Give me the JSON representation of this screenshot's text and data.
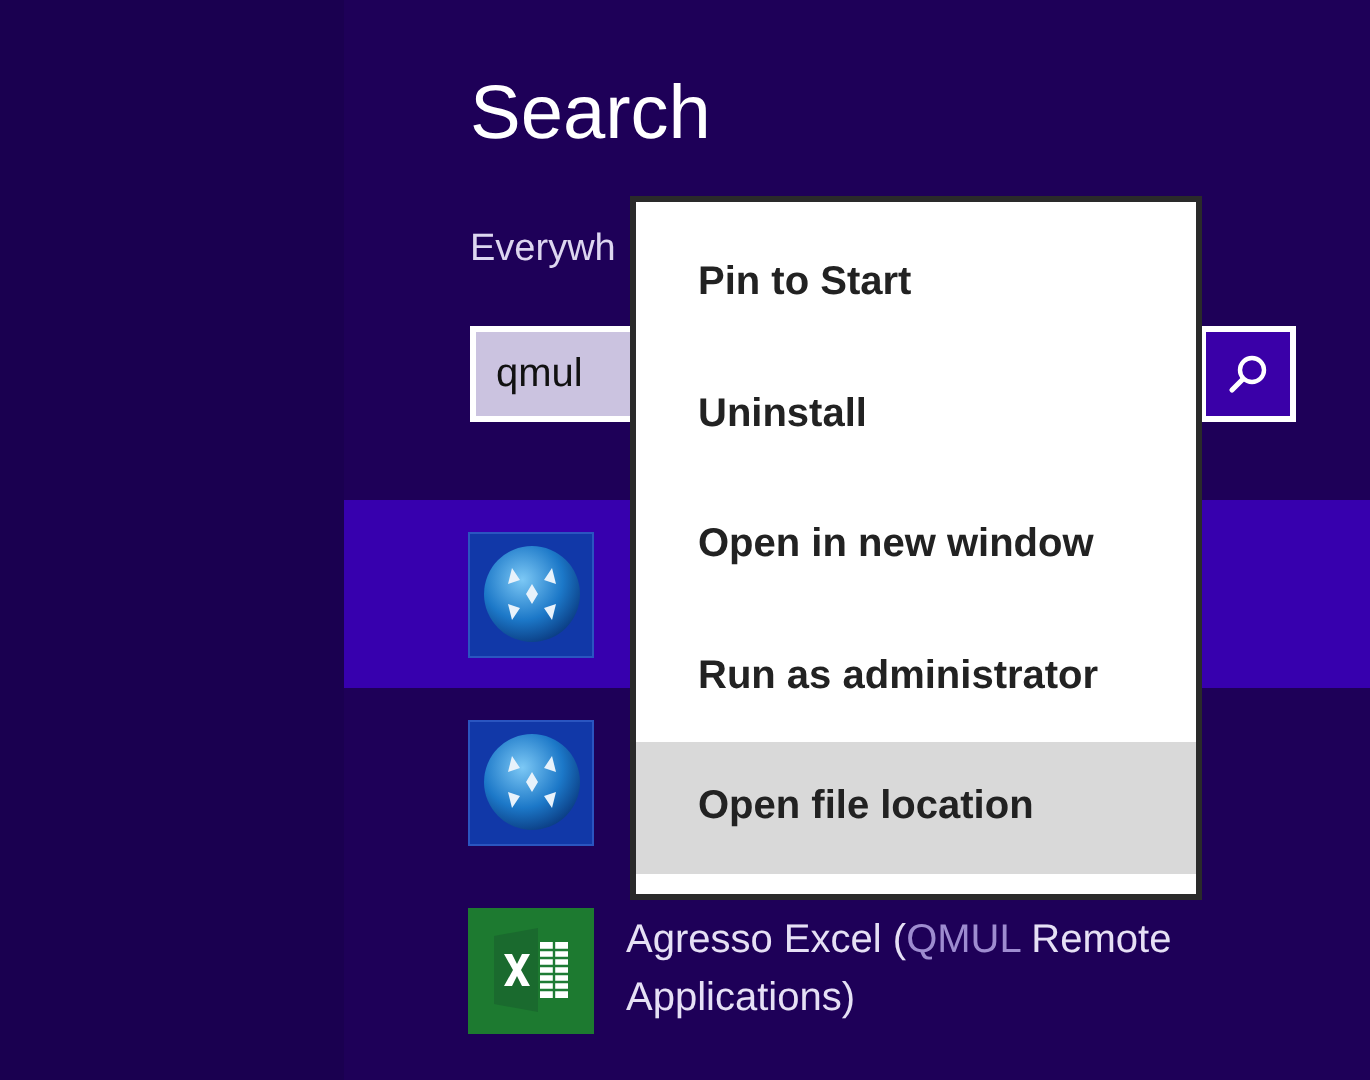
{
  "search_pane": {
    "title": "Search",
    "scope": "Everywh",
    "search": {
      "value": "qmul"
    },
    "results": [
      {
        "kind": "app-globe",
        "selected": true
      },
      {
        "kind": "app-globe",
        "selected": false
      },
      {
        "kind": "excel",
        "selected": false,
        "label": [
          {
            "text": "Agresso Excel (",
            "match": false
          },
          {
            "text": "QMUL",
            "match": true
          },
          {
            "text": " Remote Applications)",
            "match": false
          }
        ]
      }
    ]
  },
  "context_menu": {
    "items": [
      {
        "label": "Pin to Start",
        "selected": false
      },
      {
        "label": "Uninstall",
        "selected": false
      },
      {
        "label": "Open in new window",
        "selected": false
      },
      {
        "label": "Run as administrator",
        "selected": false
      },
      {
        "label": "Open file location",
        "selected": true
      }
    ]
  }
}
